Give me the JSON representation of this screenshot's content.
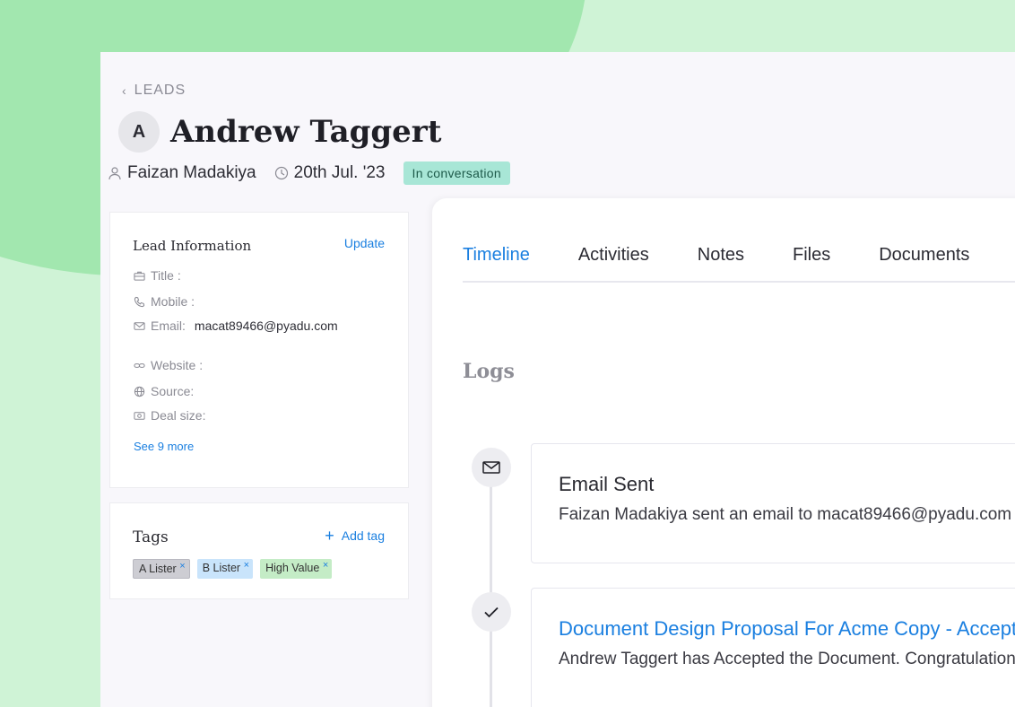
{
  "breadcrumb": {
    "label": "LEADS"
  },
  "lead": {
    "avatar_letter": "A",
    "name": "Andrew Taggert",
    "owner": "Faizan Madakiya",
    "date": "20th Jul. '23",
    "status": "In conversation"
  },
  "lead_info": {
    "title": "Lead Information",
    "update_label": "Update",
    "fields": [
      {
        "label": "Title :",
        "value": "",
        "icon": "briefcase-icon"
      },
      {
        "label": "Mobile :",
        "value": "",
        "icon": "phone-icon"
      },
      {
        "label": "Email:",
        "value": "macat89466@pyadu.com",
        "icon": "mail-icon"
      },
      {
        "label": "Website :",
        "value": "",
        "icon": "link-icon"
      },
      {
        "label": "Source:",
        "value": "",
        "icon": "globe-icon"
      },
      {
        "label": "Deal size:",
        "value": "",
        "icon": "money-icon"
      }
    ],
    "see_more": "See 9 more"
  },
  "tags": {
    "title": "Tags",
    "add_label": "Add tag",
    "items": [
      {
        "label": "A Lister",
        "x": "×"
      },
      {
        "label": "B Lister",
        "x": "×"
      },
      {
        "label": "High Value",
        "x": "×"
      }
    ]
  },
  "tabs": [
    "Timeline",
    "Activities",
    "Notes",
    "Files",
    "Documents"
  ],
  "logs": {
    "title": "Logs",
    "entries": [
      {
        "title": "Email Sent",
        "desc": "Faizan Madakiya sent an email to macat89466@pyadu.com",
        "icon": "mail-icon"
      },
      {
        "title": "Document Design Proposal For Acme Copy - Accepted",
        "desc": "Andrew Taggert has Accepted the Document. Congratulations!",
        "icon": "check-icon"
      }
    ]
  },
  "colors": {
    "accent": "#1a7fe0",
    "status_bg": "#a8e6d6",
    "bg_green": "#cff3d6",
    "blob_green": "#a2e7af"
  }
}
